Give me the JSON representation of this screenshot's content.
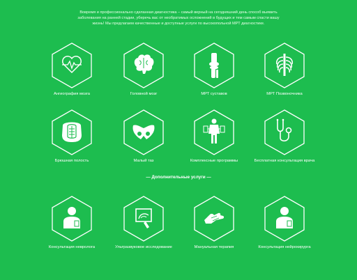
{
  "intro": "Вовремя и профессионально сделанная диагностика – самый верный на сегодняшний день способ выявить заболевания на ранней стадии, уберечь вас от необратимых осложнений в будущих и тем самым спасти вашу жизнь! Мы предлагаем качественные и доступные услуги по высокопольной МРТ диагностике.",
  "services_row1": [
    {
      "label": "Ангиография мозга",
      "icon": "heart-pulse-icon"
    },
    {
      "label": "Головной мозг",
      "icon": "brain-icon"
    },
    {
      "label": "МРТ суставов",
      "icon": "knee-joint-icon"
    },
    {
      "label": "МРТ Позвоночника",
      "icon": "ribcage-spine-icon"
    }
  ],
  "services_row2": [
    {
      "label": "Брюшная полость",
      "icon": "abdomen-icon"
    },
    {
      "label": "Малый таз",
      "icon": "pelvis-icon"
    },
    {
      "label": "Комплексные программы",
      "icon": "full-body-icon"
    },
    {
      "label": "Бесплатная консультация врача",
      "icon": "stethoscope-icon"
    }
  ],
  "additional_title": "— Дополнительные услуги —",
  "services_row3": [
    {
      "label": "Консультация невролога",
      "icon": "doctor-icon"
    },
    {
      "label": "Ультразвуковое исследование",
      "icon": "ultrasound-icon"
    },
    {
      "label": "Мануальная терапия",
      "icon": "hands-icon"
    },
    {
      "label": "Консультация нейрохирурга",
      "icon": "doctor-icon"
    }
  ]
}
